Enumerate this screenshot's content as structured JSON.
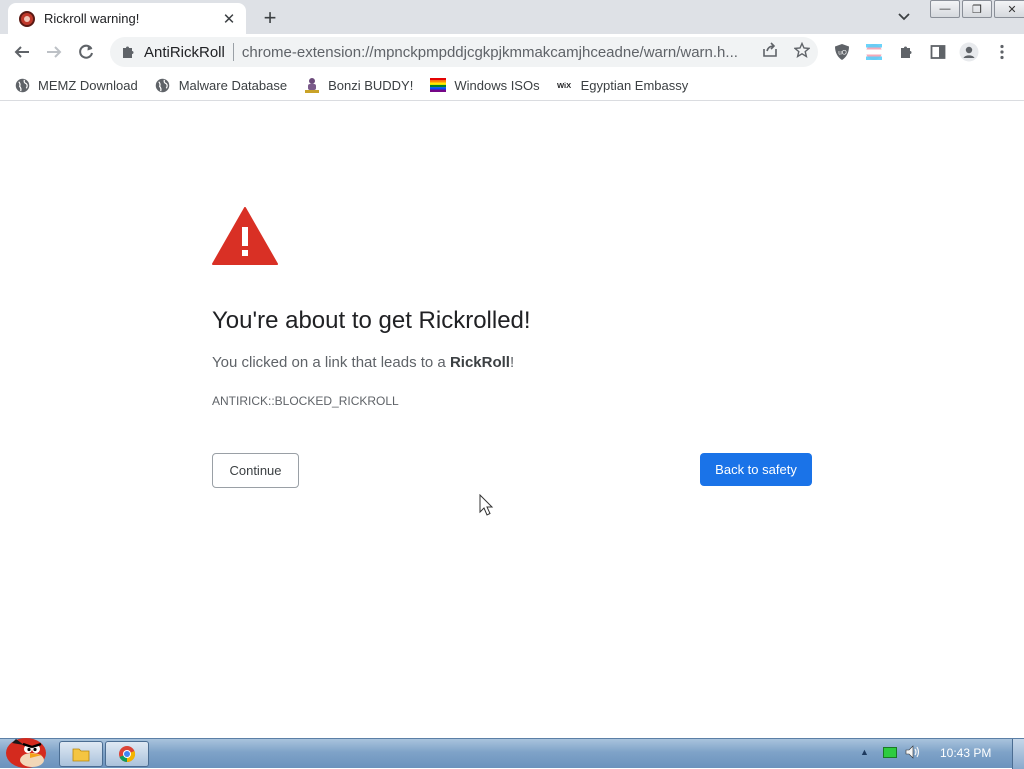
{
  "tab": {
    "title": "Rickroll warning!",
    "close": "✕",
    "new_tab": "+"
  },
  "window_controls": {
    "minimize": "—",
    "maximize": "❐",
    "close": "✕"
  },
  "toolbar": {
    "extension_name": "AntiRickRoll",
    "url": "chrome-extension://mpnckpmpddjcgkpjkmmakcamjhceadne/warn/warn.h..."
  },
  "bookmarks": [
    {
      "label": "MEMZ Download",
      "icon": "globe-icon"
    },
    {
      "label": "Malware Database",
      "icon": "globe-icon"
    },
    {
      "label": "Bonzi BUDDY!",
      "icon": "bonzi-icon"
    },
    {
      "label": "Windows ISOs",
      "icon": "rainbow-flag-icon"
    },
    {
      "label": "Egyptian Embassy",
      "icon": "wix-icon"
    }
  ],
  "page": {
    "heading": "You're about to get Rickrolled!",
    "desc_prefix": "You clicked on a link that leads to a ",
    "desc_bold": "RickRoll",
    "desc_suffix": "!",
    "error_code": "ANTIRICK::BLOCKED_RICKROLL",
    "continue_label": "Continue",
    "safety_label": "Back to safety"
  },
  "taskbar": {
    "clock": "10:43 PM"
  },
  "colors": {
    "accent": "#1a73e8",
    "warning": "#d93025"
  }
}
